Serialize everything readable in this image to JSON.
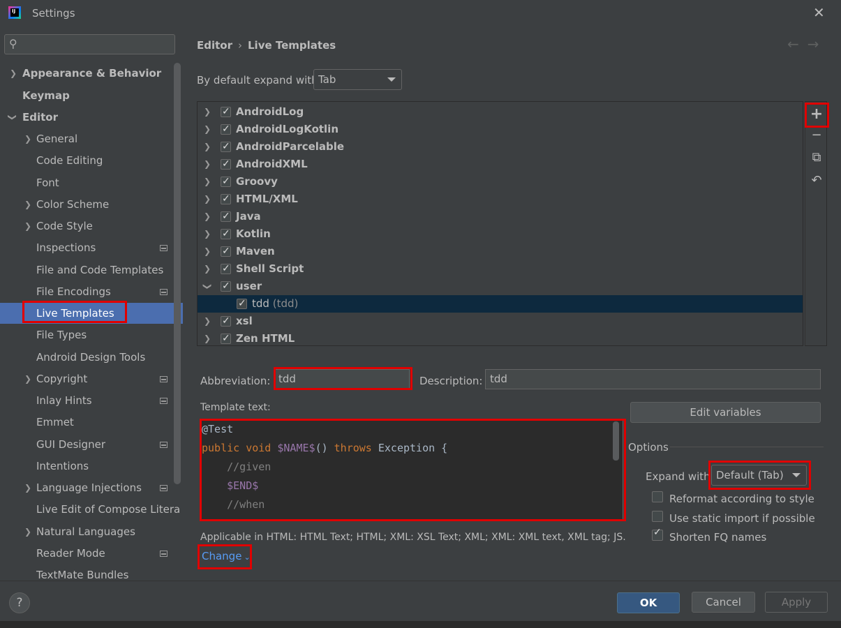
{
  "window": {
    "title": "Settings",
    "close_icon": "close-icon"
  },
  "sidebar": {
    "search": {
      "placeholder": "",
      "value": ""
    },
    "items": [
      {
        "label": "Appearance & Behavior"
      },
      {
        "label": "Keymap"
      },
      {
        "label": "Editor"
      },
      {
        "label": "General"
      },
      {
        "label": "Code Editing"
      },
      {
        "label": "Font"
      },
      {
        "label": "Color Scheme"
      },
      {
        "label": "Code Style"
      },
      {
        "label": "Inspections"
      },
      {
        "label": "File and Code Templates"
      },
      {
        "label": "File Encodings"
      },
      {
        "label": "Live Templates"
      },
      {
        "label": "File Types"
      },
      {
        "label": "Android Design Tools"
      },
      {
        "label": "Copyright"
      },
      {
        "label": "Inlay Hints"
      },
      {
        "label": "Emmet"
      },
      {
        "label": "GUI Designer"
      },
      {
        "label": "Intentions"
      },
      {
        "label": "Language Injections"
      },
      {
        "label": "Live Edit of Compose Litera"
      },
      {
        "label": "Natural Languages"
      },
      {
        "label": "Reader Mode"
      },
      {
        "label": "TextMate Bundles"
      }
    ]
  },
  "breadcrumb": {
    "parent": "Editor",
    "separator": "›",
    "current": "Live Templates"
  },
  "nav": {
    "back": "←",
    "forward": "→"
  },
  "expand_default": {
    "label": "By default expand with",
    "value": "Tab"
  },
  "template_groups": [
    {
      "label": "AndroidLog",
      "checked": true
    },
    {
      "label": "AndroidLogKotlin",
      "checked": true
    },
    {
      "label": "AndroidParcelable",
      "checked": true
    },
    {
      "label": "AndroidXML",
      "checked": true
    },
    {
      "label": "Groovy",
      "checked": true
    },
    {
      "label": "HTML/XML",
      "checked": true
    },
    {
      "label": "Java",
      "checked": true
    },
    {
      "label": "Kotlin",
      "checked": true
    },
    {
      "label": "Maven",
      "checked": true
    },
    {
      "label": "Shell Script",
      "checked": true
    },
    {
      "label": "user",
      "checked": true,
      "expanded": true
    },
    {
      "label": "tdd",
      "sub": "(tdd)",
      "checked": true,
      "selected": true
    },
    {
      "label": "xsl",
      "checked": true
    },
    {
      "label": "Zen HTML",
      "checked": true
    }
  ],
  "tools": {
    "add": "+",
    "remove": "−",
    "copy": "⧉",
    "restore": "↶"
  },
  "abbreviation": {
    "label": "Abbreviation:",
    "value": "tdd"
  },
  "description": {
    "label": "Description:",
    "value": "tdd"
  },
  "template_text": {
    "label": "Template text:",
    "lines": [
      "@Test",
      "public void $NAME$() throws Exception {",
      "    //given",
      "    $END$",
      "    //when"
    ]
  },
  "edit_variables": "Edit variables",
  "options": {
    "title": "Options",
    "expand_with": {
      "label": "Expand with",
      "value": "Default (Tab)"
    },
    "reformat": {
      "label": "Reformat according to style",
      "checked": false
    },
    "static_import": {
      "label": "Use static import if possible",
      "checked": false
    },
    "shorten_fq": {
      "label": "Shorten FQ names",
      "checked": true
    }
  },
  "applicable": "Applicable in HTML: HTML Text; HTML; XML: XSL Text; XML; XML: XML text, XML tag; JS..",
  "change_link": "Change",
  "footer": {
    "help": "?",
    "ok": "OK",
    "cancel": "Cancel",
    "apply": "Apply"
  }
}
